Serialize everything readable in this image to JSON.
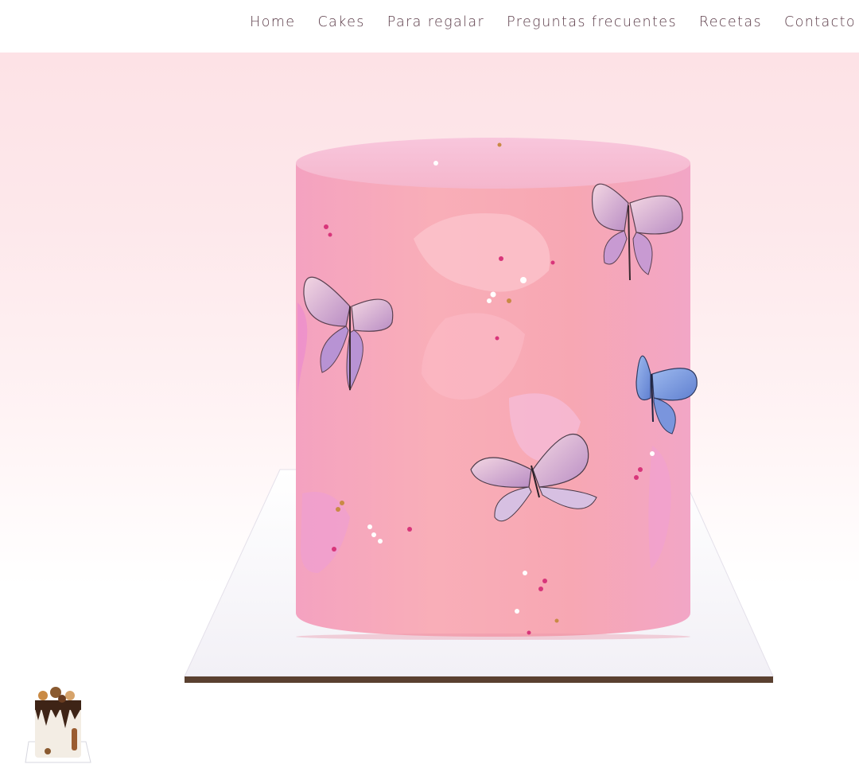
{
  "nav": {
    "items": [
      {
        "label": "Home"
      },
      {
        "label": "Cakes"
      },
      {
        "label": "Para regalar"
      },
      {
        "label": "Preguntas frecuentes"
      },
      {
        "label": "Recetas"
      },
      {
        "label": "Contacto"
      }
    ]
  },
  "colors": {
    "nav_text": "#5a3a47",
    "hero_bg_top": "#fde2e6",
    "cake_pink": "#f7a9b5",
    "board": "#ffffff"
  },
  "gallery": {
    "main_image": "pink-butterfly-cake",
    "thumbnails": [
      "drip-cake-thumbnail"
    ]
  }
}
